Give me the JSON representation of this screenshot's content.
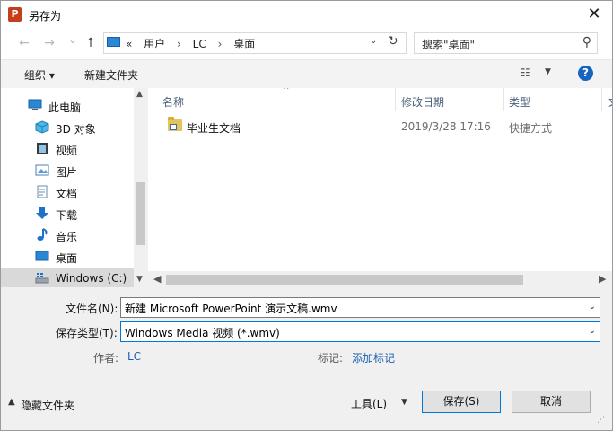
{
  "window": {
    "title": "另存为",
    "app_icon_letter": "P",
    "close_glyph": "✕"
  },
  "nav": {
    "back_glyph": "←",
    "forward_glyph": "→",
    "dropdown_glyph": "⌄",
    "up_glyph": "↑"
  },
  "address": {
    "overflow": "«",
    "crumbs": [
      "用户",
      "LC",
      "桌面"
    ],
    "separator": "›",
    "dropdown_glyph": "⌄",
    "refresh_glyph": "↻"
  },
  "search": {
    "placeholder": "搜索\"桌面\"",
    "icon_glyph": "⚲"
  },
  "toolbar": {
    "organize": "组织 ▾",
    "new_folder": "新建文件夹",
    "view_glyph": "☷",
    "view_dd": "▼",
    "help": "?"
  },
  "sidebar": {
    "items": [
      {
        "label": "此电脑",
        "icon": "computer-icon"
      },
      {
        "label": "3D 对象",
        "icon": "cube-icon"
      },
      {
        "label": "视频",
        "icon": "video-icon"
      },
      {
        "label": "图片",
        "icon": "picture-icon"
      },
      {
        "label": "文档",
        "icon": "document-icon"
      },
      {
        "label": "下载",
        "icon": "download-icon"
      },
      {
        "label": "音乐",
        "icon": "music-icon"
      },
      {
        "label": "桌面",
        "icon": "desktop-icon"
      },
      {
        "label": "Windows (C:)",
        "icon": "drive-icon"
      }
    ],
    "scroll_up": "▲",
    "scroll_down": "▼"
  },
  "files": {
    "columns": [
      "名称",
      "修改日期",
      "类型",
      "文"
    ],
    "sort_glyph": "^",
    "rows": [
      {
        "name": "毕业生文档",
        "modified": "2019/3/28 17:16",
        "type": "快捷方式"
      }
    ],
    "scroll_left": "◀",
    "scroll_right": "▶"
  },
  "form": {
    "filename_label": "文件名(N):",
    "filename_value": "新建 Microsoft PowerPoint 演示文稿.wmv",
    "filetype_label": "保存类型(T):",
    "filetype_value": "Windows Media 视频 (*.wmv)",
    "dropdown_glyph": "⌄",
    "author_label": "作者:",
    "author_value": "LC",
    "tags_label": "标记:",
    "tags_value": "添加标记"
  },
  "footer": {
    "hide_folders": "隐藏文件夹",
    "hide_glyph": "▲",
    "tools": "工具(L)",
    "tools_glyph": "▼",
    "save": "保存(S)",
    "cancel": "取消",
    "grip": "⋰"
  },
  "colors": {
    "accent": "#0078d7",
    "link": "#1a5fb4"
  }
}
